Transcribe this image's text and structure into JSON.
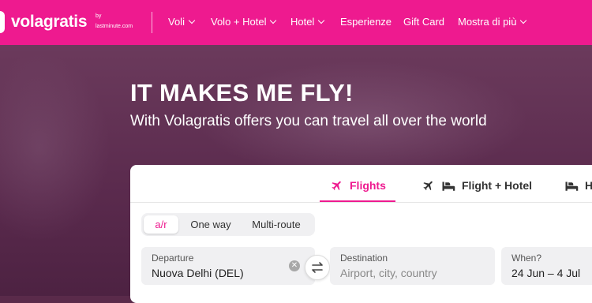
{
  "brand": {
    "name": "volagratis",
    "by": "by",
    "partner": "lastminute.com"
  },
  "nav": {
    "items": [
      {
        "label": "Voli",
        "dropdown": true
      },
      {
        "label": "Volo + Hotel",
        "dropdown": true
      },
      {
        "label": "Hotel",
        "dropdown": true
      },
      {
        "label": "Esperienze",
        "dropdown": false
      },
      {
        "label": "Gift Card",
        "dropdown": false
      },
      {
        "label": "Mostra di più",
        "dropdown": true
      }
    ]
  },
  "hero": {
    "title": "IT MAKES ME FLY!",
    "subtitle": "With Volagratis offers you can travel all over the world"
  },
  "search": {
    "tabs": [
      {
        "label": "Flights",
        "icon": "plane-icon",
        "active": true
      },
      {
        "label": "Flight + Hotel",
        "icon": "plane-bed-icon",
        "active": false
      },
      {
        "label": "H",
        "icon": "bed-icon",
        "active": false
      }
    ],
    "trip_types": [
      {
        "label": "a/r",
        "selected": true
      },
      {
        "label": "One way",
        "selected": false
      },
      {
        "label": "Multi-route",
        "selected": false
      }
    ],
    "departure": {
      "label": "Departure",
      "value": "Nuova Delhi (DEL)"
    },
    "destination": {
      "label": "Destination",
      "placeholder": "Airport, city, country"
    },
    "when": {
      "label": "When?",
      "value": "24 Jun – 4 Jul"
    }
  },
  "colors": {
    "brand": "#ee1a8f",
    "hero": "#5a2a4d",
    "field_bg": "#f0f0f2"
  }
}
